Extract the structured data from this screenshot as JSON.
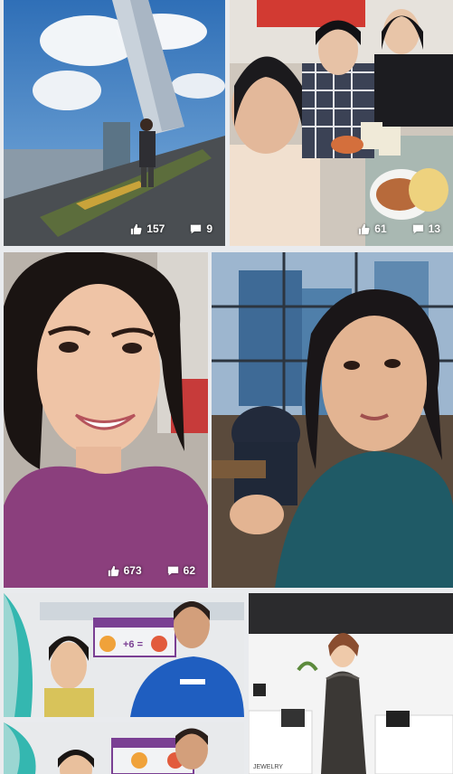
{
  "colors": {
    "background": "#e9ebee",
    "overlay_text": "#ffffff"
  },
  "icons": {
    "like": "thumbs-up-icon",
    "comment": "speech-bubble-icon"
  },
  "posts": [
    {
      "likes": "157",
      "comments": "9"
    },
    {
      "likes": "61",
      "comments": "13"
    },
    {
      "likes": "673",
      "comments": "62"
    },
    {
      "likes": "",
      "comments": ""
    },
    {
      "likes": "",
      "comments": ""
    },
    {
      "likes": "",
      "comments": ""
    },
    {
      "likes": "",
      "comments": ""
    }
  ],
  "signs": {
    "promo_top": "+6 =",
    "promo_bottom": "",
    "store": "JEWELRY"
  }
}
